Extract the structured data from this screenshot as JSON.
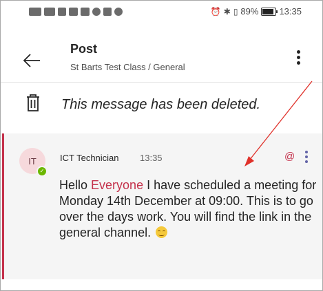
{
  "status_bar": {
    "time": "13:35",
    "battery": "89%",
    "left_icons": [
      "volte-icon",
      "signal-4g-icon",
      "nfc-icon",
      "app-notification-icon",
      "gmail-icon",
      "whatsapp-icon",
      "app-icon",
      "facebook-icon"
    ],
    "right_icons": [
      "alarm-icon",
      "bluetooth-icon",
      "vibrate-icon"
    ]
  },
  "header": {
    "title": "Post",
    "subtitle": "St Barts Test Class / General"
  },
  "deleted_message": {
    "text": "This message has been deleted."
  },
  "message": {
    "avatar_initials": "IT",
    "author": "ICT Technician",
    "time": "13:35",
    "body_start": "Hello ",
    "mention": "Everyone",
    "body_end": " I have scheduled a meeting for Monday 14th December at 09:00. This is to go over the days work. You will find the link in the general channel. ",
    "emoji": "smile-emoji"
  },
  "colors": {
    "accent": "#c4314b",
    "presence": "#6bb700",
    "annotation_arrow": "#e0312a"
  }
}
